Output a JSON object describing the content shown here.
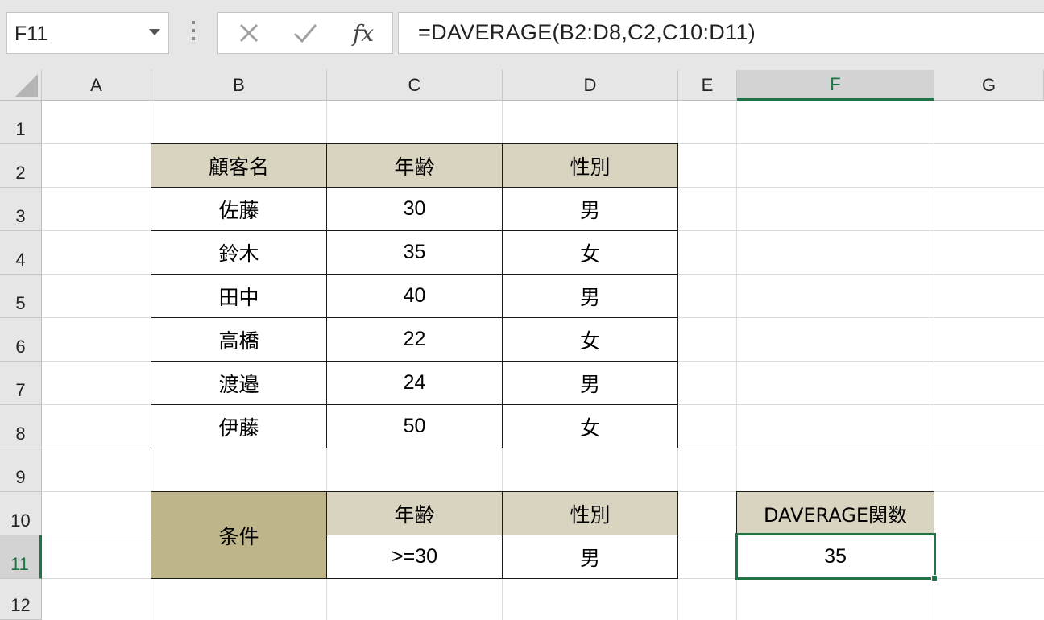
{
  "formula_bar": {
    "name_box": "F11",
    "fx_label": "fx",
    "formula": "=DAVERAGE(B2:D8,C2,C10:D11)"
  },
  "columns": [
    "A",
    "B",
    "C",
    "D",
    "E",
    "F",
    "G"
  ],
  "rows": [
    "1",
    "2",
    "3",
    "4",
    "5",
    "6",
    "7",
    "8",
    "9",
    "10",
    "11",
    "12"
  ],
  "active_cell": "F11",
  "table": {
    "headers": [
      "顧客名",
      "年齢",
      "性別"
    ],
    "rows": [
      [
        "佐藤",
        "30",
        "男"
      ],
      [
        "鈴木",
        "35",
        "女"
      ],
      [
        "田中",
        "40",
        "男"
      ],
      [
        "高橋",
        "22",
        "女"
      ],
      [
        "渡邉",
        "24",
        "男"
      ],
      [
        "伊藤",
        "50",
        "女"
      ]
    ]
  },
  "criteria": {
    "label": "条件",
    "headers": [
      "年齢",
      "性別"
    ],
    "values": [
      ">=30",
      "男"
    ]
  },
  "result": {
    "header": "DAVERAGE関数",
    "value": "35"
  },
  "colors": {
    "header_fill": "#d9d4bf",
    "criteria_fill": "#bfb58a",
    "selection": "#217346"
  }
}
